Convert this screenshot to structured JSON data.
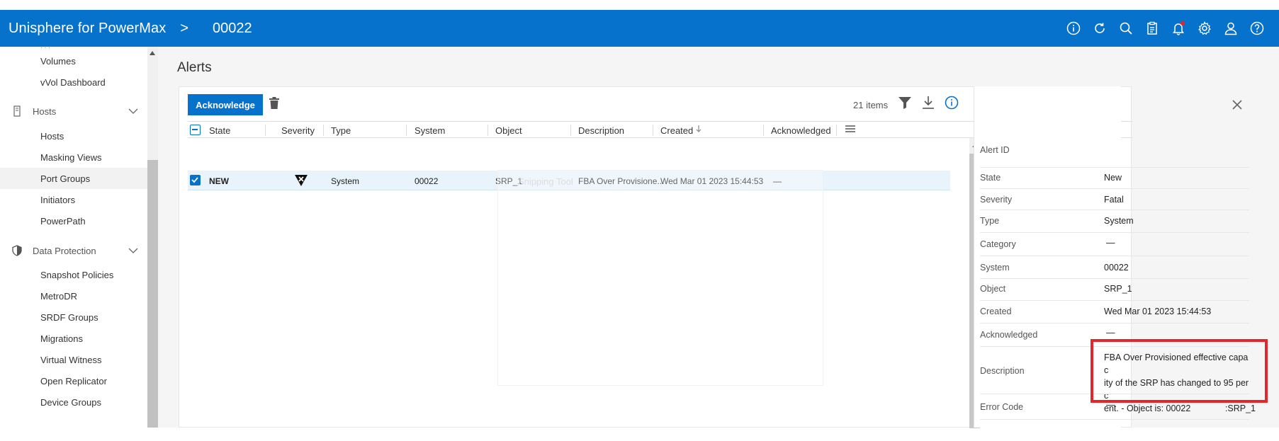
{
  "header": {
    "app_title": "Unisphere for PowerMax",
    "separator": ">",
    "breadcrumb": "00022",
    "icons": [
      "info-icon",
      "refresh-icon",
      "search-icon",
      "clipboard-icon",
      "bell-icon",
      "gear-icon",
      "user-icon",
      "help-icon"
    ]
  },
  "sidebar": {
    "partial_top": "Volumes",
    "items": [
      {
        "label": "Volumes",
        "type": "item"
      },
      {
        "label": "vVol Dashboard",
        "type": "item"
      },
      {
        "label": "Hosts",
        "type": "group",
        "icon": "server-icon"
      },
      {
        "label": "Hosts",
        "type": "item"
      },
      {
        "label": "Masking Views",
        "type": "item"
      },
      {
        "label": "Port Groups",
        "type": "item",
        "selected": true
      },
      {
        "label": "Initiators",
        "type": "item"
      },
      {
        "label": "PowerPath",
        "type": "item"
      },
      {
        "label": "Data Protection",
        "type": "group",
        "icon": "shield-icon"
      },
      {
        "label": "Snapshot Policies",
        "type": "item"
      },
      {
        "label": "MetroDR",
        "type": "item"
      },
      {
        "label": "SRDF Groups",
        "type": "item"
      },
      {
        "label": "Migrations",
        "type": "item"
      },
      {
        "label": "Virtual Witness",
        "type": "item"
      },
      {
        "label": "Open Replicator",
        "type": "item"
      },
      {
        "label": "Device Groups",
        "type": "item"
      }
    ]
  },
  "main": {
    "title": "Alerts",
    "toolbar": {
      "acknowledge_label": "Acknowledge",
      "items_count": "21 items"
    },
    "columns": [
      "State",
      "Severity",
      "Type",
      "System",
      "Object",
      "Description",
      "Created",
      "Acknowledged"
    ],
    "sorted_column": "Created",
    "rows": [
      {
        "checked": true,
        "state": "NEW",
        "severity": "fatal-icon",
        "type": "System",
        "system": "00022",
        "object": "SRP_1",
        "description": "FBA Over Provisione...",
        "created": "Wed Mar 01 2023 15:44:53",
        "acknowledged": "—"
      }
    ],
    "ghost_window_label": "Snipping Tool"
  },
  "detail": {
    "fields": [
      {
        "label": "Alert ID",
        "value": ""
      },
      {
        "label": "State",
        "value": "New"
      },
      {
        "label": "Severity",
        "value": "Fatal"
      },
      {
        "label": "Type",
        "value": "System"
      },
      {
        "label": "Category",
        "value": "—"
      },
      {
        "label": "System",
        "value": "00022"
      },
      {
        "label": "Object",
        "value": "SRP_1"
      },
      {
        "label": "Created",
        "value": "Wed Mar 01 2023 15:44:53"
      },
      {
        "label": "Acknowledged",
        "value": "—"
      },
      {
        "label": "Description",
        "value": ""
      },
      {
        "label": "Error Code",
        "value": "—"
      }
    ],
    "description_lines": [
      "FBA Over Provisioned effective capac",
      "ity of the SRP has changed to 95 perc",
      "ent. - Object is: 00022              :SRP_1"
    ],
    "highlight_color": "#e3262c"
  },
  "colors": {
    "brand": "#0672cb",
    "selected_row": "#e8f3fb"
  }
}
